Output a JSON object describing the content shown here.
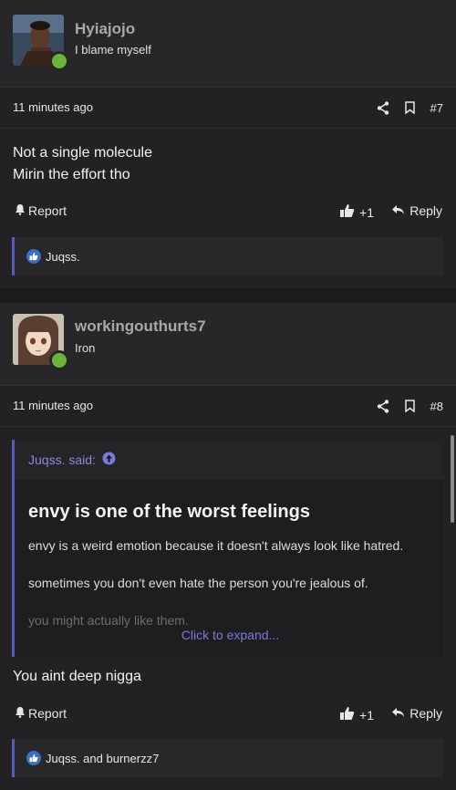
{
  "posts": [
    {
      "username": "Hyiajojo",
      "user_title": "I blame myself",
      "timestamp": "11 minutes ago",
      "post_number": "#7",
      "message_lines": [
        "Not a single molecule",
        "Mirin the effort tho"
      ],
      "report_label": "Report",
      "like_count": "+1",
      "reply_label": "Reply",
      "liked_by": "Juqss."
    },
    {
      "username": "workingouthurts7",
      "user_title": "Iron",
      "timestamp": "11 minutes ago",
      "post_number": "#8",
      "quote": {
        "author": "Juqss. said:",
        "title": "envy is one of the worst feelings",
        "lines": [
          "envy is a weird emotion because it doesn't always look like hatred.",
          "sometimes you don't even hate the person you're jealous of.",
          "you might actually like them."
        ],
        "expand_label": "Click to expand..."
      },
      "message_lines": [
        "You aint deep nigga"
      ],
      "report_label": "Report",
      "like_count": "+1",
      "reply_label": "Reply",
      "liked_by": "Juqss. and burnerzz7"
    }
  ],
  "colors": {
    "accent": "#5a5ab8",
    "online": "#6bb43b",
    "like_badge": "#3b6fc4"
  }
}
